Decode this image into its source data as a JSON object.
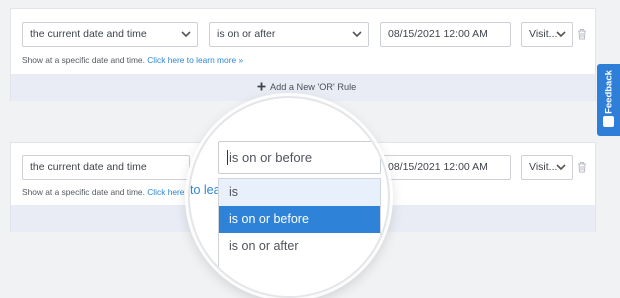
{
  "rule1": {
    "condition": "the current date and time",
    "operator": "is on or after",
    "value": "08/15/2021 12:00 AM",
    "timezone": "Visit...",
    "hint_text": "Show at a specific date and time.",
    "hint_link": "Click here to learn more »"
  },
  "add_or_rule": {
    "icon": "plus-icon",
    "label": "Add a New 'OR' Rule"
  },
  "rule2": {
    "condition": "the current date and time",
    "value": "08/15/2021 12:00 AM",
    "timezone": "Visit...",
    "hint_text": "Show at a specific date and time.",
    "hint_link": "Click here to lea"
  },
  "magnifier": {
    "input_value": "is on or before",
    "behind_text": "to lea",
    "options": [
      {
        "label": "is",
        "state": "hover"
      },
      {
        "label": "is on or before",
        "state": "selected"
      },
      {
        "label": "is on or after",
        "state": "normal"
      }
    ]
  },
  "feedback": {
    "label": "Feedback"
  },
  "colors": {
    "accent": "#2e83d8",
    "link": "#2e86d6",
    "band": "#e9ecf4"
  }
}
